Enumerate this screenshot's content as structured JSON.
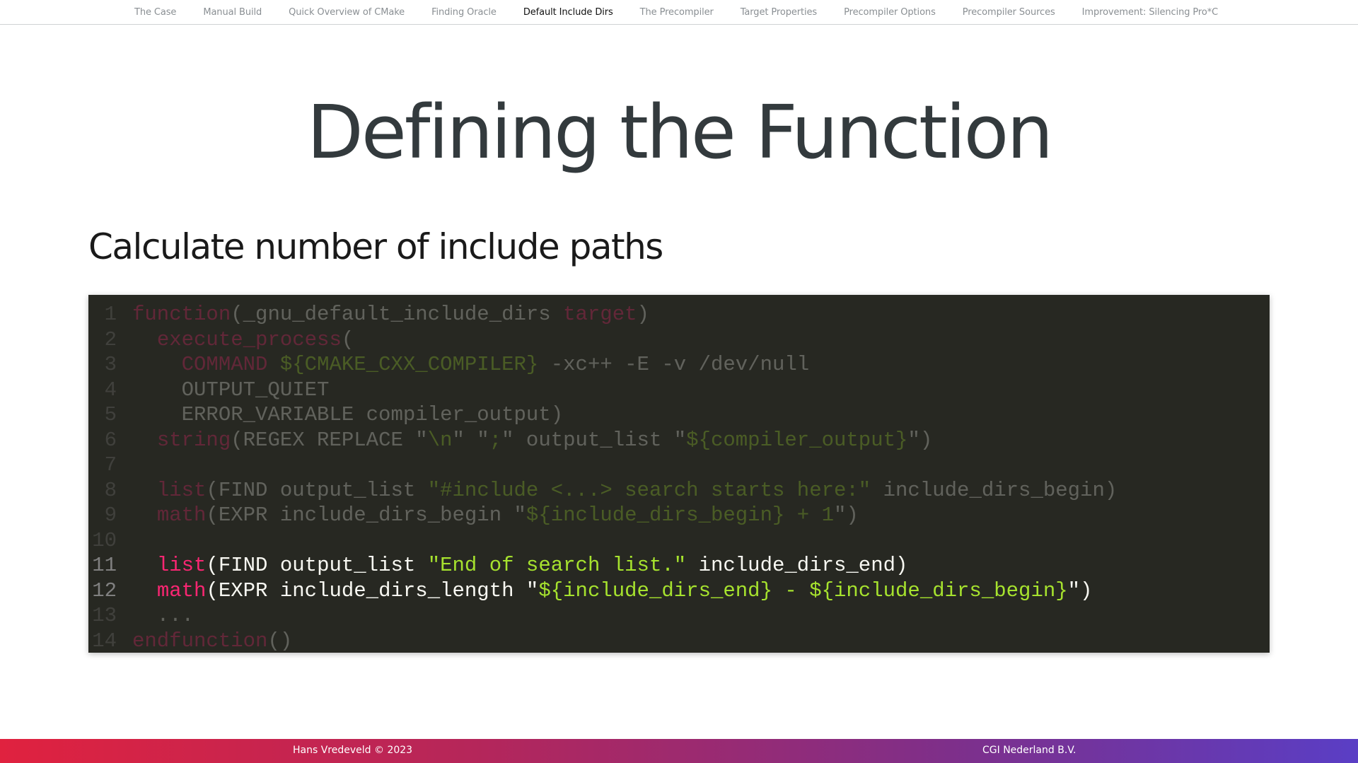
{
  "nav": {
    "items": [
      {
        "label": "The Case",
        "active": false
      },
      {
        "label": "Manual Build",
        "active": false
      },
      {
        "label": "Quick Overview of CMake",
        "active": false
      },
      {
        "label": "Finding Oracle",
        "active": false
      },
      {
        "label": "Default Include Dirs",
        "active": true
      },
      {
        "label": "The Precompiler",
        "active": false
      },
      {
        "label": "Target Properties",
        "active": false
      },
      {
        "label": "Precompiler Options",
        "active": false
      },
      {
        "label": "Precompiler Sources",
        "active": false
      },
      {
        "label": "Improvement: Silencing Pro*C",
        "active": false
      }
    ]
  },
  "slide": {
    "title": "Defining the Function",
    "subheading": "Calculate number of include paths"
  },
  "code": {
    "background": "#272822",
    "colors": {
      "text": "#f8f8f2",
      "keyword": "#f92672",
      "string": "#a6e22e",
      "line_number": "#808080"
    },
    "highlighted_lines": [
      11,
      12
    ],
    "lines": [
      {
        "n": "1",
        "tokens": [
          {
            "t": "function",
            "c": "kw"
          },
          {
            "t": "(_gnu_default_include_dirs ",
            "c": "txt"
          },
          {
            "t": "target",
            "c": "kw"
          },
          {
            "t": ")",
            "c": "txt"
          }
        ]
      },
      {
        "n": "2",
        "tokens": [
          {
            "t": "  ",
            "c": "txt"
          },
          {
            "t": "execute_process",
            "c": "kw"
          },
          {
            "t": "(",
            "c": "txt"
          }
        ]
      },
      {
        "n": "3",
        "tokens": [
          {
            "t": "    ",
            "c": "txt"
          },
          {
            "t": "COMMAND",
            "c": "kw"
          },
          {
            "t": " ",
            "c": "txt"
          },
          {
            "t": "${CMAKE_CXX_COMPILER}",
            "c": "str"
          },
          {
            "t": " -xc++ -E -v /dev/null",
            "c": "txt"
          }
        ]
      },
      {
        "n": "4",
        "tokens": [
          {
            "t": "    OUTPUT_QUIET",
            "c": "txt"
          }
        ]
      },
      {
        "n": "5",
        "tokens": [
          {
            "t": "    ERROR_VARIABLE compiler_output)",
            "c": "txt"
          }
        ]
      },
      {
        "n": "6",
        "tokens": [
          {
            "t": "  ",
            "c": "txt"
          },
          {
            "t": "string",
            "c": "kw"
          },
          {
            "t": "(REGEX REPLACE ",
            "c": "txt"
          },
          {
            "t": "\"",
            "c": "txt"
          },
          {
            "t": "\\n",
            "c": "str"
          },
          {
            "t": "\" \"",
            "c": "txt"
          },
          {
            "t": ";",
            "c": "str"
          },
          {
            "t": "\" output_list \"",
            "c": "txt"
          },
          {
            "t": "${compiler_output}",
            "c": "str"
          },
          {
            "t": "\")",
            "c": "txt"
          }
        ]
      },
      {
        "n": "7",
        "tokens": []
      },
      {
        "n": "8",
        "tokens": [
          {
            "t": "  ",
            "c": "txt"
          },
          {
            "t": "list",
            "c": "kw"
          },
          {
            "t": "(FIND output_list ",
            "c": "txt"
          },
          {
            "t": "\"#include <...> search starts here:\"",
            "c": "str"
          },
          {
            "t": " include_dirs_begin)",
            "c": "txt"
          }
        ]
      },
      {
        "n": "9",
        "tokens": [
          {
            "t": "  ",
            "c": "txt"
          },
          {
            "t": "math",
            "c": "kw"
          },
          {
            "t": "(EXPR include_dirs_begin ",
            "c": "txt"
          },
          {
            "t": "\"",
            "c": "txt"
          },
          {
            "t": "${include_dirs_begin} + 1",
            "c": "str"
          },
          {
            "t": "\")",
            "c": "txt"
          }
        ]
      },
      {
        "n": "10",
        "tokens": []
      },
      {
        "n": "11",
        "tokens": [
          {
            "t": "  ",
            "c": "txt"
          },
          {
            "t": "list",
            "c": "kw"
          },
          {
            "t": "(FIND output_list ",
            "c": "txt"
          },
          {
            "t": "\"End of search list.\"",
            "c": "str"
          },
          {
            "t": " include_dirs_end)",
            "c": "txt"
          }
        ]
      },
      {
        "n": "12",
        "tokens": [
          {
            "t": "  ",
            "c": "txt"
          },
          {
            "t": "math",
            "c": "kw"
          },
          {
            "t": "(EXPR include_dirs_length ",
            "c": "txt"
          },
          {
            "t": "\"",
            "c": "txt"
          },
          {
            "t": "${include_dirs_end} - ${include_dirs_begin}",
            "c": "str"
          },
          {
            "t": "\")",
            "c": "txt"
          }
        ]
      },
      {
        "n": "13",
        "tokens": [
          {
            "t": "  ...",
            "c": "txt"
          }
        ]
      },
      {
        "n": "14",
        "tokens": [
          {
            "t": "endfunction",
            "c": "kw"
          },
          {
            "t": "()",
            "c": "txt"
          }
        ]
      }
    ]
  },
  "footer": {
    "author": "Hans Vredeveld © 2023",
    "company": "CGI Nederland B.V."
  }
}
